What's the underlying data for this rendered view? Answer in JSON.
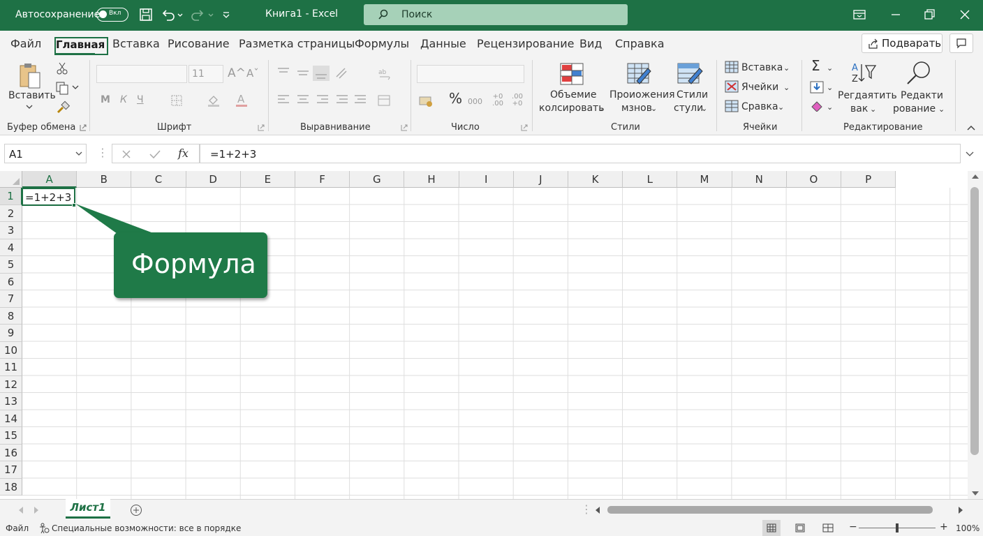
{
  "titlebar": {
    "autosave_label": "Автосохранение",
    "autosave_state": "Вкл",
    "doc_title": "Книга1  -  Excel",
    "search_placeholder": "Поиск"
  },
  "menu": {
    "tabs": [
      "Файл",
      "Главная",
      "Вставка",
      "Рисование",
      "Разметка страницы",
      "Формулы",
      "Данные",
      "Рецензирование",
      "Вид",
      "Справка"
    ],
    "active_tab": "Главная",
    "share_label": "Подварать"
  },
  "ribbon": {
    "clipboard": {
      "paste": "Вставить",
      "group": "Буфер обмена"
    },
    "font": {
      "size": "11",
      "bold": "М",
      "italic": "К",
      "underline": "Ч",
      "group": "Шрифт"
    },
    "alignment": {
      "group": "Выравнивание"
    },
    "number": {
      "group": "Число",
      "percent": "%",
      "comma": "000",
      "inc_dec": "+0 .00",
      "dec_dec": ".00 +0"
    },
    "styles": {
      "cond_format_1": "Объемие",
      "cond_format_2": "колсировать",
      "format_table_1": "Проиожения",
      "format_table_2": "мзнов",
      "cell_styles_1": "Стили",
      "cell_styles_2": "стули",
      "group": "Стили"
    },
    "cells": {
      "insert": "Вставка",
      "delete": "Ячейки",
      "format": "Сравка",
      "group": "Ячейки"
    },
    "editing": {
      "sort_1": "Регдаятить",
      "sort_2": "вак",
      "find_1": "Редакти",
      "find_2": "рование",
      "group": "Редактирование"
    }
  },
  "formula_bar": {
    "name_box": "A1",
    "fx": "fx",
    "formula": "=1+2+3"
  },
  "grid": {
    "columns": [
      "A",
      "B",
      "C",
      "D",
      "E",
      "F",
      "G",
      "H",
      "I",
      "J",
      "K",
      "L",
      "M",
      "N",
      "O",
      "P"
    ],
    "rows": [
      "1",
      "2",
      "3",
      "4",
      "5",
      "6",
      "7",
      "8",
      "9",
      "10",
      "11",
      "12",
      "13",
      "14",
      "15",
      "16",
      "17",
      "18"
    ],
    "active_cell_value": "=1+2+3"
  },
  "callout": {
    "text": "Формула"
  },
  "sheets": {
    "active": "Лист1"
  },
  "status": {
    "mode": "Файл",
    "accessibility": "Специальные возможности: все в порядке",
    "zoom": "100%"
  },
  "colors": {
    "brand": "#1e7145",
    "search_bg": "#a6d1b8",
    "callout": "#1f7a48"
  }
}
